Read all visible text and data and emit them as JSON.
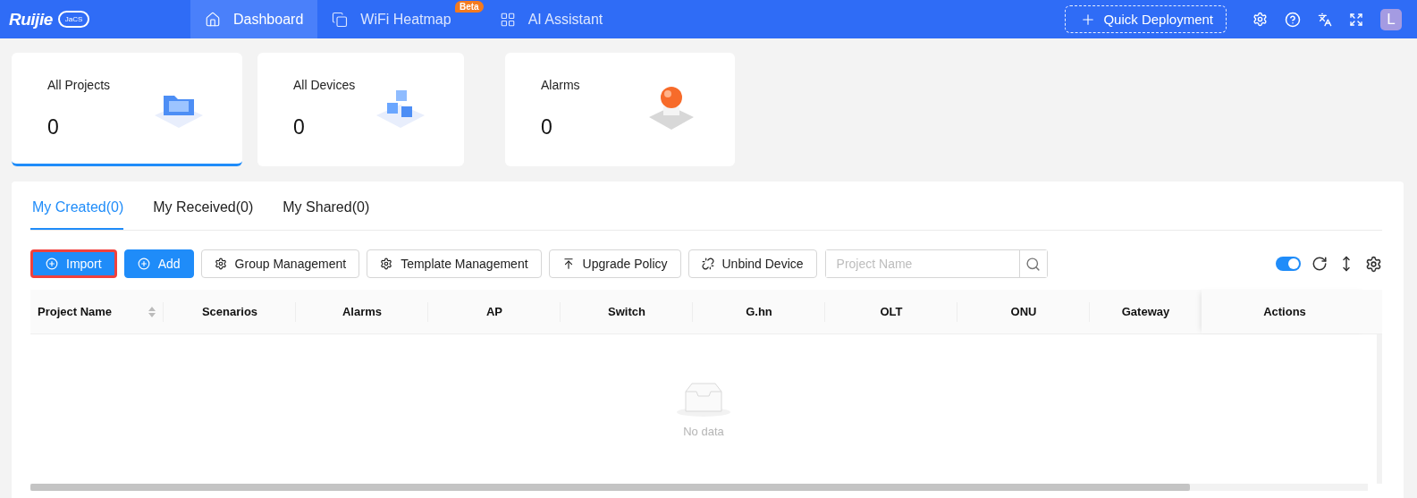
{
  "header": {
    "logo": {
      "wordmark": "Ruijie",
      "badge": "JaCS"
    },
    "nav": [
      {
        "label": "Dashboard",
        "selected": true
      },
      {
        "label": "WiFi Heatmap",
        "selected": false,
        "badge": "Beta"
      },
      {
        "label": "AI Assistant",
        "selected": false
      }
    ],
    "quick_deployment": "Quick Deployment",
    "avatar": "L"
  },
  "stat_cards": [
    {
      "label": "All Projects",
      "value": "0",
      "selected": true
    },
    {
      "label": "All Devices",
      "value": "0",
      "selected": false
    },
    {
      "label": "Alarms",
      "value": "0",
      "selected": false
    }
  ],
  "tabs": [
    {
      "label": "My Created(0)",
      "selected": true
    },
    {
      "label": "My Received(0)",
      "selected": false
    },
    {
      "label": "My Shared(0)",
      "selected": false
    }
  ],
  "toolbar": {
    "buttons": [
      {
        "label": "Import",
        "kind": "primary",
        "highlighted": true
      },
      {
        "label": "Add",
        "kind": "primary",
        "highlighted": false
      },
      {
        "label": "Group Management",
        "kind": "default",
        "highlighted": false
      },
      {
        "label": "Template Management",
        "kind": "default",
        "highlighted": false
      },
      {
        "label": "Upgrade Policy",
        "kind": "default",
        "highlighted": false
      },
      {
        "label": "Unbind Device",
        "kind": "default",
        "highlighted": false
      }
    ],
    "search": {
      "placeholder": "Project Name"
    },
    "switch": {
      "on": true
    }
  },
  "table": {
    "columns": [
      {
        "label": "Project Name",
        "sortable": true
      },
      {
        "label": "Scenarios",
        "sortable": false
      },
      {
        "label": "Alarms",
        "sortable": false
      },
      {
        "label": "AP",
        "sortable": false
      },
      {
        "label": "Switch",
        "sortable": false
      },
      {
        "label": "G.hn",
        "sortable": false
      },
      {
        "label": "OLT",
        "sortable": false
      },
      {
        "label": "ONU",
        "sortable": false
      },
      {
        "label": "Gateway",
        "sortable": false
      },
      {
        "label": "Actions",
        "sortable": false
      }
    ],
    "empty_text": "No data"
  }
}
